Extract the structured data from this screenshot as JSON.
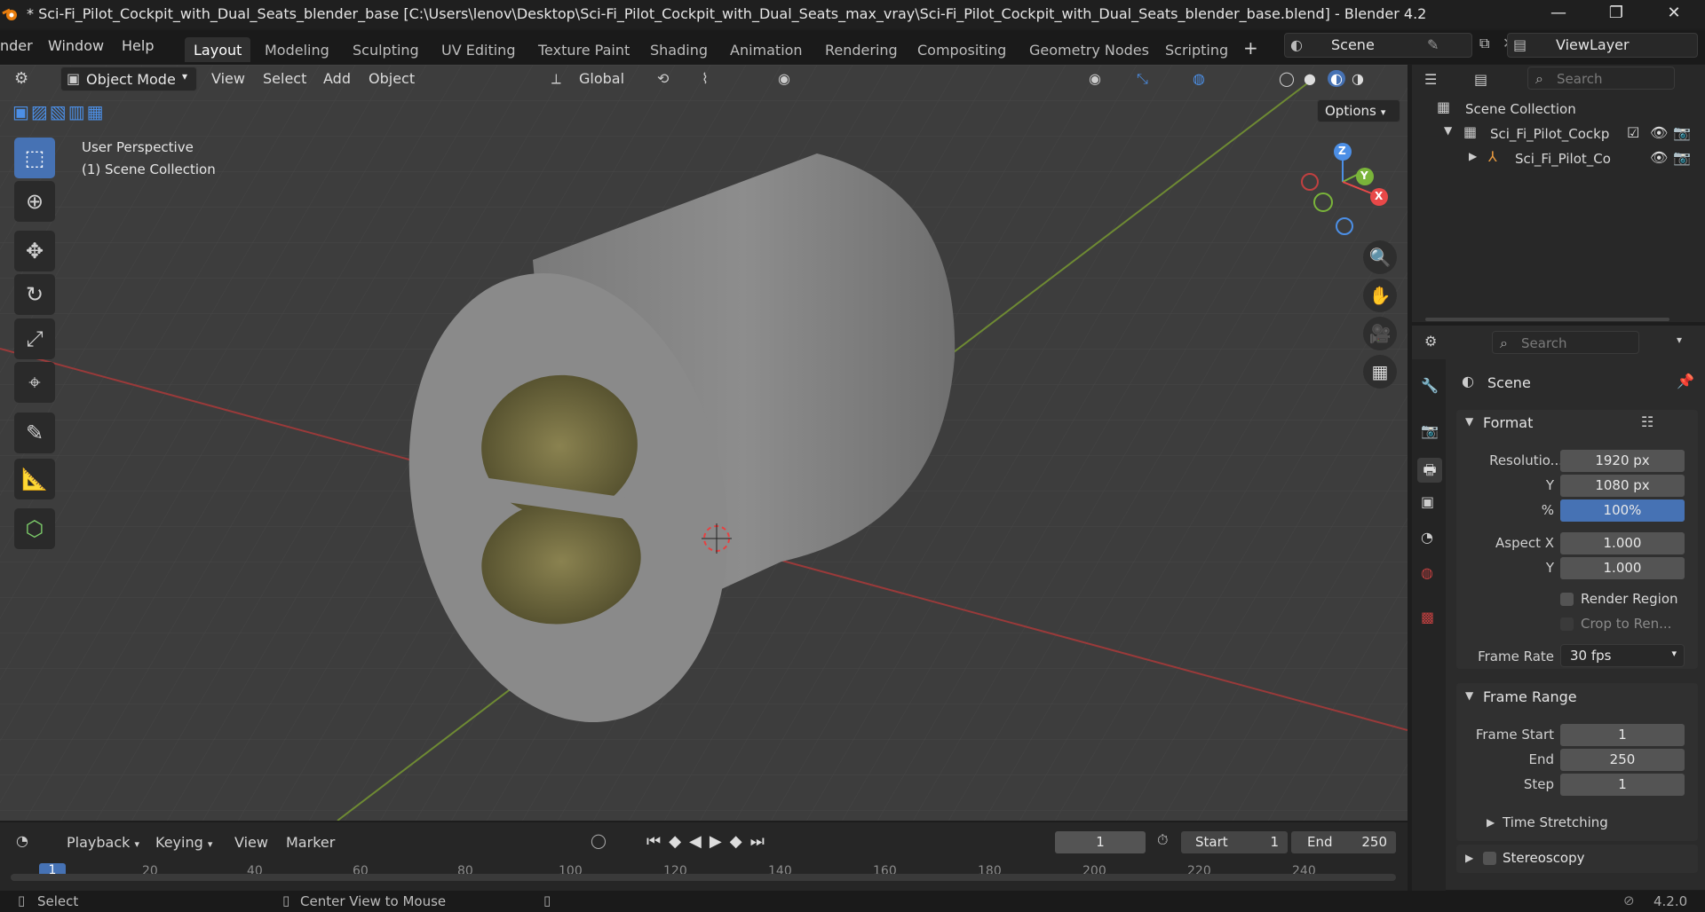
{
  "window": {
    "title": "* Sci-Fi_Pilot_Cockpit_with_Dual_Seats_blender_base [C:\\Users\\lenov\\Desktop\\Sci-Fi_Pilot_Cockpit_with_Dual_Seats_max_vray\\Sci-Fi_Pilot_Cockpit_with_Dual_Seats_blender_base.blend] - Blender 4.2",
    "minimize": "—",
    "maximize": "❐",
    "close": "✕"
  },
  "menu": {
    "render": "nder",
    "window": "Window",
    "help": "Help"
  },
  "workspaces": [
    "Layout",
    "Modeling",
    "Sculpting",
    "UV Editing",
    "Texture Paint",
    "Shading",
    "Animation",
    "Rendering",
    "Compositing",
    "Geometry Nodes",
    "Scripting"
  ],
  "workspace_add": "+",
  "scene": {
    "name": "Scene",
    "viewlayer": "ViewLayer"
  },
  "viewport_header": {
    "mode": "Object Mode",
    "menus": [
      "View",
      "Select",
      "Add",
      "Object"
    ],
    "orientation": "Global",
    "options": "Options"
  },
  "viewport": {
    "perspective": "User Perspective",
    "collection": "(1) Scene Collection",
    "gizmo": {
      "z": "Z",
      "y": "Y",
      "x": "X"
    }
  },
  "outliner": {
    "search_placeholder": "Search",
    "root": "Scene Collection",
    "collection": "Sci_Fi_Pilot_Cockp",
    "object": "Sci_Fi_Pilot_Co"
  },
  "properties": {
    "search_placeholder": "Search",
    "context": "Scene",
    "format_panel": "Format",
    "resolution_label": "Resolutio...",
    "res_x": "1920 px",
    "y_label": "Y",
    "res_y": "1080 px",
    "pct_label": "%",
    "res_pct": "100%",
    "res_pct_value": 100,
    "aspect_x_label": "Aspect X",
    "aspect_x": "1.000",
    "aspect_y": "1.000",
    "render_region": "Render Region",
    "crop": "Crop to Ren...",
    "frame_rate_label": "Frame Rate",
    "frame_rate": "30 fps",
    "frame_range_panel": "Frame Range",
    "frame_start_label": "Frame Start",
    "frame_start": "1",
    "end_label": "End",
    "end": "250",
    "step_label": "Step",
    "step": "1",
    "time_stretching": "Time Stretching",
    "stereoscopy": "Stereoscopy"
  },
  "timeline": {
    "playback": "Playback",
    "keying": "Keying",
    "view": "View",
    "marker": "Marker",
    "current_frame": "1",
    "start_label": "Start",
    "start": "1",
    "end_label": "End",
    "end": "250",
    "ticks": [
      "20",
      "40",
      "60",
      "80",
      "100",
      "120",
      "140",
      "160",
      "180",
      "200",
      "220",
      "240"
    ],
    "playhead": "1"
  },
  "status": {
    "select": "Select",
    "center": "Center View to Mouse",
    "version": "4.2.0"
  }
}
